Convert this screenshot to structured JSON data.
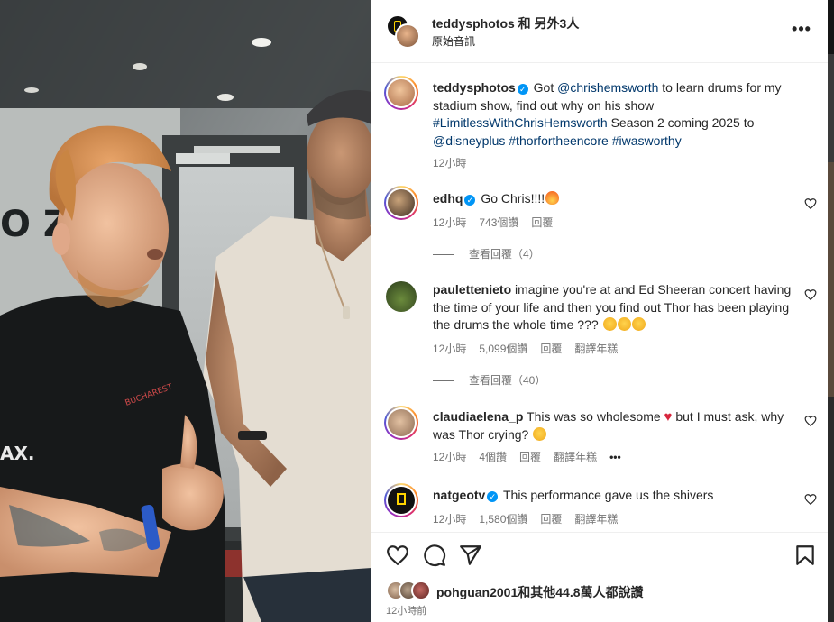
{
  "header": {
    "name": "teddysphotos 和 另外3人",
    "subtitle": "原始音訊",
    "more": "•••"
  },
  "caption": {
    "username": "teddysphotos",
    "text_before": " Got ",
    "mention1": "@chrishemsworth",
    "text_mid": " to learn drums for my stadium show, find out why on his show ",
    "hashtag1": "#LimitlessWithChrisHemsworth",
    "text_mid2": " Season 2 coming 2025 to ",
    "mention2": "@disneyplus",
    "hashtag2": "#thorfortheencore",
    "hashtag3": "#iwasworthy",
    "time": "12小時"
  },
  "comments": [
    {
      "username": "edhq",
      "verified": true,
      "text": "Go Chris!!!!",
      "time": "12小時",
      "likes": "743個讚",
      "reply": "回覆",
      "view_replies": "查看回覆（4）"
    },
    {
      "username": "pauletteniet o",
      "username_clean": "pauletteniet",
      "text": "imagine you're at and Ed Sheeran concert having the time of your life and then you find out Thor has been playing the drums the whole time ???",
      "time": "12小時",
      "likes": "5,099個讚",
      "reply": "回覆",
      "translate": "翻譯年糕",
      "view_replies": "查看回覆（40）"
    },
    {
      "username": "claudiaelena_p",
      "text_before": "This was so wholesome",
      "text_after": "but I must ask, why was Thor crying?",
      "time": "12小時",
      "likes": "4個讚",
      "reply": "回覆",
      "translate": "翻譯年糕",
      "more": "•••"
    },
    {
      "username": "natgeotv",
      "verified": true,
      "text": "This performance gave us the shivers",
      "time": "12小時",
      "likes": "1,580個讚",
      "reply": "回覆",
      "translate": "翻譯年糕"
    }
  ],
  "footer": {
    "likes_text": "pohguan2001和其他44.8萬人都說讚",
    "time": "12小時前"
  },
  "photo": {
    "shirt_text": "BUCHAREST",
    "wall_text": "O Z",
    "max_text": "AX."
  },
  "icons": {
    "like": "heart-icon",
    "comment": "comment-icon",
    "share": "share-icon",
    "save": "bookmark-icon",
    "verified": "verified-badge-icon",
    "fire": "fire-emoji-icon",
    "cry": "crying-emoji-icon",
    "sad": "sad-emoji-icon",
    "red_heart": "red-heart-emoji-icon"
  },
  "colors": {
    "link": "#00376b",
    "verified": "#0095f6",
    "muted": "#737373",
    "text": "#262626"
  }
}
